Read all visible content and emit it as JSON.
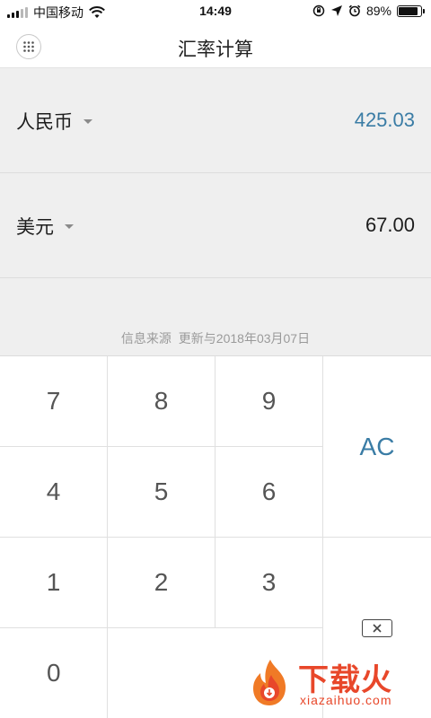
{
  "status_bar": {
    "carrier": "中国移动",
    "time": "14:49",
    "battery": "89%",
    "battery_level": 0.89
  },
  "nav": {
    "title": "汇率计算"
  },
  "currencies": [
    {
      "name": "人民币",
      "value": "425.03",
      "active": true
    },
    {
      "name": "美元",
      "value": "67.00",
      "active": false
    }
  ],
  "source": {
    "label": "信息来源",
    "updated": "更新与2018年03月07日"
  },
  "keypad": {
    "k7": "7",
    "k8": "8",
    "k9": "9",
    "k4": "4",
    "k5": "5",
    "k6": "6",
    "k1": "1",
    "k2": "2",
    "k3": "3",
    "k0": "0",
    "clear": "AC"
  },
  "colors": {
    "accent": "#3a7ca5",
    "watermark": "#e8472a"
  },
  "watermark": {
    "text": "下载火",
    "domain": "xiazaihuo.com"
  }
}
